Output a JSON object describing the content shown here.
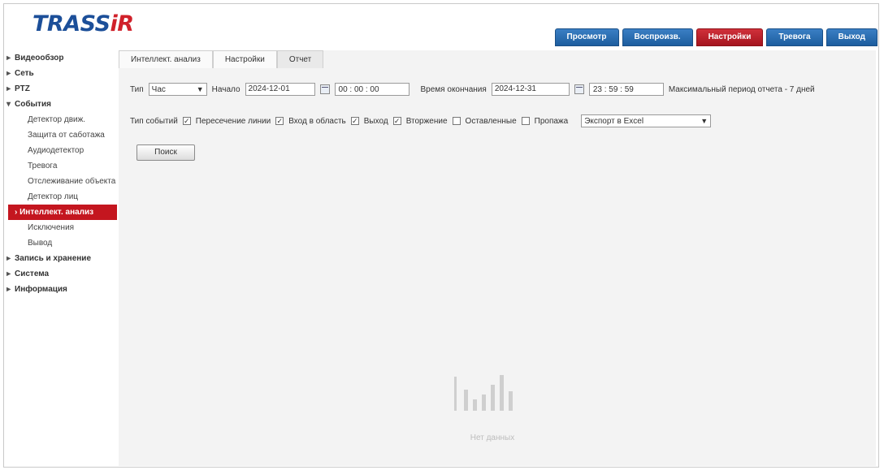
{
  "app": {
    "logo_text": "TRASS",
    "logo_accent": "iR",
    "brand_color": "#1c4f99",
    "accent_color": "#c4161f"
  },
  "topnav": [
    {
      "label": "Просмотр",
      "active": false
    },
    {
      "label": "Воспроизв.",
      "active": false
    },
    {
      "label": "Настройки",
      "active": true
    },
    {
      "label": "Тревога",
      "active": false
    },
    {
      "label": "Выход",
      "active": false
    }
  ],
  "sidebar": {
    "items": [
      {
        "label": "Видеообзор",
        "kind": "top",
        "arrow": "▸"
      },
      {
        "label": "Сеть",
        "kind": "top",
        "arrow": "▸"
      },
      {
        "label": "PTZ",
        "kind": "top",
        "arrow": "▸"
      },
      {
        "label": "События",
        "kind": "top",
        "arrow": "▾"
      },
      {
        "label": "Детектор движ.",
        "kind": "sub"
      },
      {
        "label": "Защита от саботажа",
        "kind": "sub"
      },
      {
        "label": "Аудиодетектор",
        "kind": "sub"
      },
      {
        "label": "Тревога",
        "kind": "sub"
      },
      {
        "label": "Отслеживание объекта",
        "kind": "sub"
      },
      {
        "label": "Детектор лиц",
        "kind": "sub"
      },
      {
        "label": "Интеллект. анализ",
        "kind": "sub",
        "active": true
      },
      {
        "label": "Исключения",
        "kind": "sub"
      },
      {
        "label": "Вывод",
        "kind": "sub"
      },
      {
        "label": "Запись и хранение",
        "kind": "top",
        "arrow": "▸"
      },
      {
        "label": "Система",
        "kind": "top",
        "arrow": "▸"
      },
      {
        "label": "Информация",
        "kind": "top",
        "arrow": "▸"
      }
    ]
  },
  "tabs": [
    {
      "label": "Интеллект. анализ",
      "active": false
    },
    {
      "label": "Настройки",
      "active": false
    },
    {
      "label": "Отчет",
      "active": true
    }
  ],
  "filters": {
    "type_label": "Тип",
    "type_value": "Час",
    "start_label": "Начало",
    "start_date": "2024-12-01",
    "start_time": "00 : 00 : 00",
    "end_label": "Время окончания",
    "end_date": "2024-12-31",
    "end_time": "23 : 59 : 59",
    "hint": "Максимальный период отчета - 7 дней"
  },
  "events": {
    "label": "Тип событий",
    "options": [
      {
        "label": "Пересечение линии",
        "checked": true
      },
      {
        "label": "Вход в область",
        "checked": true
      },
      {
        "label": "Выход",
        "checked": true
      },
      {
        "label": "Вторжение",
        "checked": true
      },
      {
        "label": "Оставленные",
        "checked": false
      },
      {
        "label": "Пропажа",
        "checked": false
      }
    ],
    "export_label": "Экспорт в Excel"
  },
  "apply_label": "Поиск",
  "empty_state": {
    "label": "Нет данных"
  }
}
